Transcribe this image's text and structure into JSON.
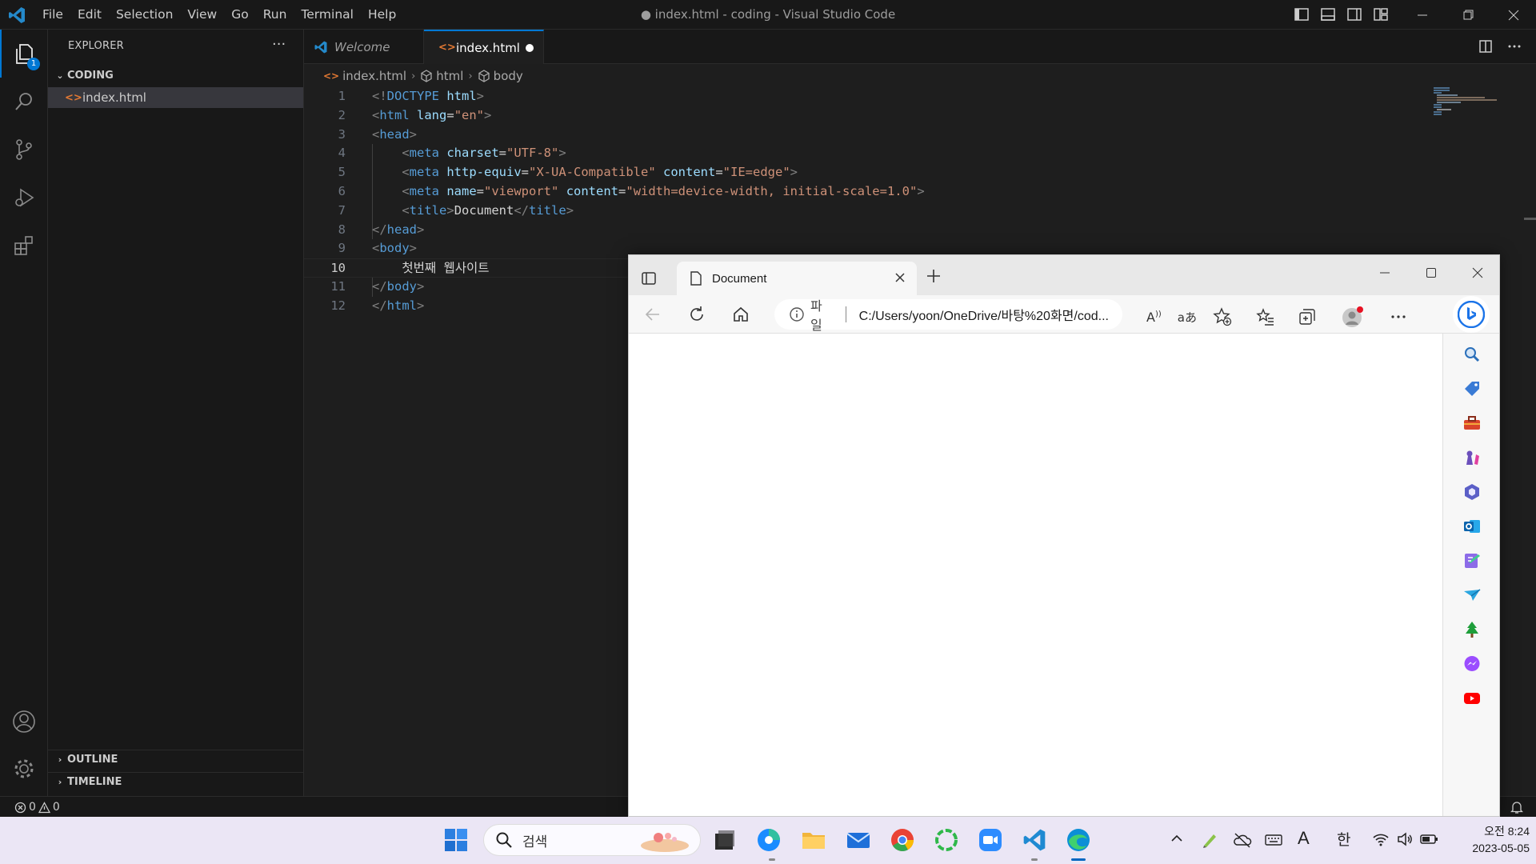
{
  "window": {
    "title": "● index.html - coding - Visual Studio Code",
    "menu": [
      "File",
      "Edit",
      "Selection",
      "View",
      "Go",
      "Run",
      "Terminal",
      "Help"
    ]
  },
  "activity_bar": {
    "items": [
      "explorer-icon",
      "search-icon",
      "source-control-icon",
      "run-debug-icon",
      "extensions-icon"
    ],
    "explorer_badge": "1",
    "bottom": [
      "account-icon",
      "settings-gear-icon"
    ]
  },
  "sidebar": {
    "title": "EXPLORER",
    "more": "···",
    "folder": "CODING",
    "file": "index.html",
    "outline": "OUTLINE",
    "timeline": "TIMELINE"
  },
  "tabs": [
    {
      "label": "Welcome",
      "active": false
    },
    {
      "label": "index.html",
      "active": true,
      "dirty": true
    }
  ],
  "breadcrumb": [
    "index.html",
    "html",
    "body"
  ],
  "code": {
    "current_line": 10,
    "line_numbers": [
      "1",
      "2",
      "3",
      "4",
      "5",
      "6",
      "7",
      "8",
      "9",
      "10",
      "11",
      "12"
    ],
    "lines": [
      {
        "indent": "",
        "parts": [
          [
            "p",
            "<!"
          ],
          [
            "t",
            "DOCTYPE"
          ],
          [
            "w",
            " "
          ],
          [
            "a",
            "html"
          ],
          [
            "p",
            ">"
          ]
        ]
      },
      {
        "indent": "",
        "parts": [
          [
            "p",
            "<"
          ],
          [
            "t",
            "html"
          ],
          [
            "w",
            " "
          ],
          [
            "a",
            "lang"
          ],
          [
            "w",
            "="
          ],
          [
            "s",
            "\"en\""
          ],
          [
            "p",
            ">"
          ]
        ]
      },
      {
        "indent": "",
        "parts": [
          [
            "p",
            "<"
          ],
          [
            "t",
            "head"
          ],
          [
            "p",
            ">"
          ]
        ]
      },
      {
        "indent": "    ",
        "parts": [
          [
            "p",
            "<"
          ],
          [
            "t",
            "meta"
          ],
          [
            "w",
            " "
          ],
          [
            "a",
            "charset"
          ],
          [
            "w",
            "="
          ],
          [
            "s",
            "\"UTF-8\""
          ],
          [
            "p",
            ">"
          ]
        ]
      },
      {
        "indent": "    ",
        "parts": [
          [
            "p",
            "<"
          ],
          [
            "t",
            "meta"
          ],
          [
            "w",
            " "
          ],
          [
            "a",
            "http-equiv"
          ],
          [
            "w",
            "="
          ],
          [
            "s",
            "\"X-UA-Compatible\""
          ],
          [
            "w",
            " "
          ],
          [
            "a",
            "content"
          ],
          [
            "w",
            "="
          ],
          [
            "s",
            "\"IE=edge\""
          ],
          [
            "p",
            ">"
          ]
        ]
      },
      {
        "indent": "    ",
        "parts": [
          [
            "p",
            "<"
          ],
          [
            "t",
            "meta"
          ],
          [
            "w",
            " "
          ],
          [
            "a",
            "name"
          ],
          [
            "w",
            "="
          ],
          [
            "s",
            "\"viewport\""
          ],
          [
            "w",
            " "
          ],
          [
            "a",
            "content"
          ],
          [
            "w",
            "="
          ],
          [
            "s",
            "\"width=device-width, initial-scale=1.0\""
          ],
          [
            "p",
            ">"
          ]
        ]
      },
      {
        "indent": "    ",
        "parts": [
          [
            "p",
            "<"
          ],
          [
            "t",
            "title"
          ],
          [
            "p",
            ">"
          ],
          [
            "w",
            "Document"
          ],
          [
            "p",
            "</"
          ],
          [
            "t",
            "title"
          ],
          [
            "p",
            ">"
          ]
        ]
      },
      {
        "indent": "",
        "parts": [
          [
            "p",
            "</"
          ],
          [
            "t",
            "head"
          ],
          [
            "p",
            ">"
          ]
        ]
      },
      {
        "indent": "",
        "parts": [
          [
            "p",
            "<"
          ],
          [
            "t",
            "body"
          ],
          [
            "p",
            ">"
          ]
        ]
      },
      {
        "indent": "    ",
        "parts": [
          [
            "w",
            "첫번째 웹사이트"
          ]
        ]
      },
      {
        "indent": "",
        "parts": [
          [
            "p",
            "</"
          ],
          [
            "t",
            "body"
          ],
          [
            "p",
            ">"
          ]
        ]
      },
      {
        "indent": "",
        "parts": [
          [
            "p",
            "</"
          ],
          [
            "t",
            "html"
          ],
          [
            "p",
            ">"
          ]
        ]
      }
    ]
  },
  "status": {
    "errors": "0",
    "warnings": "0"
  },
  "browser": {
    "tab_title": "Document",
    "address_scheme": "파일",
    "address_url": "C:/Users/yoon/OneDrive/바탕%20화면/cod...",
    "sidebar_icons": [
      "bing-icon",
      "search-icon",
      "shopping-tag-icon",
      "toolbox-icon",
      "games-icon",
      "microsoft365-icon",
      "outlook-icon",
      "drop-icon",
      "send-icon",
      "tree-icon",
      "messenger-icon",
      "youtube-icon"
    ]
  },
  "taskbar": {
    "search_label": "검색",
    "apps": [
      "start-icon",
      "file-icon",
      "chrome-like-icon",
      "folder-icon",
      "mail-icon",
      "chrome-icon",
      "ring-icon",
      "zoom-icon",
      "vscode-icon",
      "edge-icon"
    ],
    "time": "오전 8:24",
    "date": "2023-05-05",
    "ime_letter": "A",
    "ime_lang": "한"
  },
  "colors": {
    "accent": "#0078d4",
    "modified_file": "#e37933",
    "tag": "#569cd6",
    "attribute": "#9cdcfe",
    "string": "#ce9178"
  }
}
